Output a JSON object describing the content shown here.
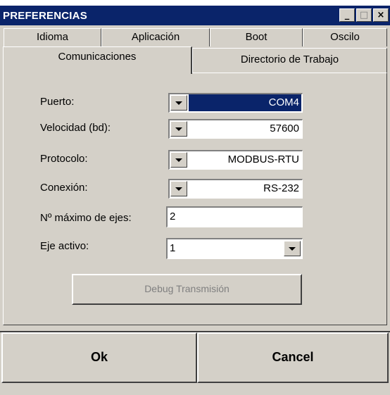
{
  "window": {
    "title": "PREFERENCIAS",
    "controls": {
      "minimize": "_",
      "maximize": "□",
      "close": "×"
    }
  },
  "tabs": {
    "row1": [
      "Idioma",
      "Aplicación",
      "Boot",
      "Oscilo"
    ],
    "row2": [
      "Comunicaciones",
      "Directorio de Trabajo"
    ]
  },
  "form": {
    "puerto_label": "Puerto:",
    "puerto_value": "COM4",
    "velocidad_label": "Velocidad (bd):",
    "velocidad_value": "57600",
    "protocolo_label": "Protocolo:",
    "protocolo_value": "MODBUS-RTU",
    "conexion_label": "Conexión:",
    "conexion_value": "RS-232",
    "max_ejes_label": "Nº máximo de ejes:",
    "max_ejes_value": "2",
    "eje_activo_label": "Eje activo:",
    "eje_activo_value": "1"
  },
  "debug_label": "Debug Transmisión",
  "buttons": {
    "ok": "Ok",
    "cancel": "Cancel"
  },
  "colors": {
    "titlebar": "#0a246a",
    "face": "#d4d0c8",
    "selection": "#0a246a"
  }
}
